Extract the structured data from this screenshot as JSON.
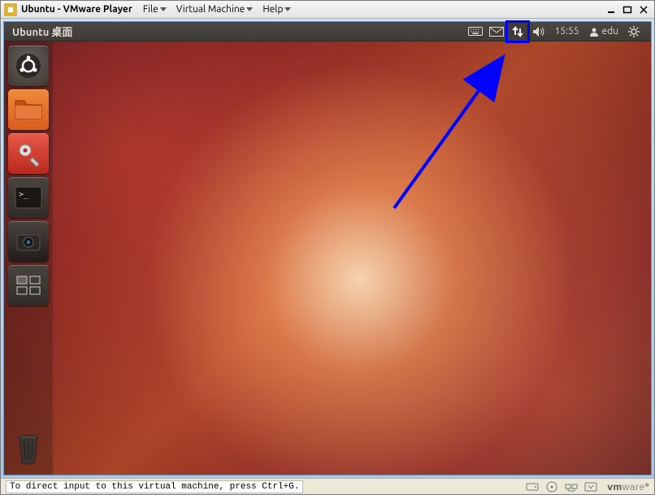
{
  "vmware": {
    "title": "Ubuntu - VMware Player",
    "menus": [
      "File",
      "Virtual Machine",
      "Help"
    ]
  },
  "ubuntu": {
    "panel_title": "Ubuntu 桌面",
    "time": "15:55",
    "user": "edu"
  },
  "launcher": {
    "items": [
      "dash",
      "files",
      "settings",
      "terminal",
      "camera",
      "workspace"
    ]
  },
  "statusbar": {
    "text": "To direct input to this virtual machine, press Ctrl+G.",
    "brand_bold": "vm",
    "brand_rest": "ware"
  },
  "annotation": {
    "highlight": "network-indicator"
  }
}
